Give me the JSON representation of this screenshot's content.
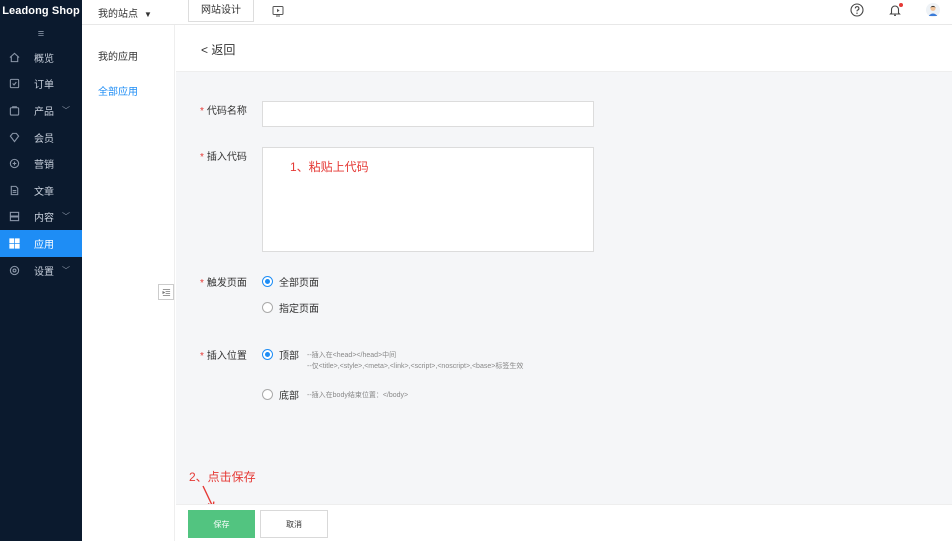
{
  "brand": {
    "logo_text": "Leadong Shop"
  },
  "sidebar": {
    "collapse_glyph": "≡",
    "items": [
      {
        "label": "概览",
        "icon": "home-icon",
        "has_children": false
      },
      {
        "label": "订单",
        "icon": "order-icon",
        "has_children": false
      },
      {
        "label": "产品",
        "icon": "bag-icon",
        "has_children": true
      },
      {
        "label": "会员",
        "icon": "diamond-icon",
        "has_children": false
      },
      {
        "label": "营销",
        "icon": "marketing-icon",
        "has_children": false
      },
      {
        "label": "文章",
        "icon": "document-icon",
        "has_children": false
      },
      {
        "label": "内容",
        "icon": "content-icon",
        "has_children": true
      },
      {
        "label": "应用",
        "icon": "apps-icon",
        "has_children": false,
        "active": true
      },
      {
        "label": "设置",
        "icon": "settings-icon",
        "has_children": true
      }
    ]
  },
  "topbar": {
    "site_select_label": "我的站点",
    "site_design_label": "网站设计",
    "icons": [
      "preview-icon",
      "help-icon",
      "bell-icon",
      "avatar"
    ]
  },
  "submenu": {
    "items": [
      {
        "label": "我的应用",
        "active": false
      },
      {
        "label": "全部应用",
        "active": true
      }
    ]
  },
  "page": {
    "back_label": "< 返回",
    "fields": {
      "code_name_label": "代码名称",
      "code_name_value": "",
      "insert_code_label": "插入代码",
      "insert_code_annotation": "1、粘贴上代码",
      "trigger_page_label": "触发页面",
      "trigger_options": [
        {
          "label": "全部页面",
          "checked": true
        },
        {
          "label": "指定页面",
          "checked": false
        }
      ],
      "position_label": "插入位置",
      "position_options": [
        {
          "label": "顶部",
          "checked": true,
          "hint": "--插入在<head></head>中间",
          "hint2": "--仅<title>,<style>,<meta>,<link>,<script>,<noscript>,<base>标签生效"
        },
        {
          "label": "底部",
          "checked": false,
          "hint": "--插入在body结束位置：</body>"
        }
      ]
    },
    "step2_annotation": "2、点击保存",
    "footer": {
      "save_label": "保存",
      "cancel_label": "取消"
    }
  },
  "colors": {
    "sidebar_bg": "#0b1a2e",
    "accent": "#1e8df5",
    "save_green": "#52c480",
    "annotation_red": "#e53935"
  }
}
